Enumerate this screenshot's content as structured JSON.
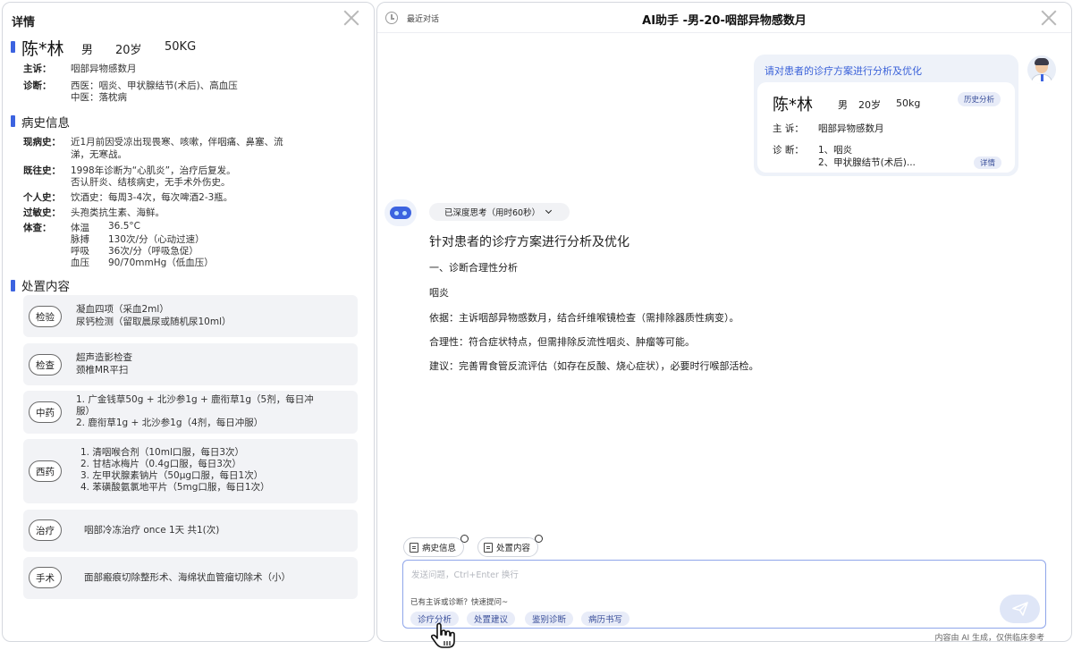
{
  "left": {
    "title": "详情",
    "patient": {
      "name": "陈*林",
      "sex": "男",
      "age": "20岁",
      "weight": "50KG"
    },
    "complaint_label": "主诉：",
    "complaint": "咽部异物感数月",
    "diagnosis_label": "诊断：",
    "diagnosis_western": "西医：咽炎、甲状腺结节(术后)、高血压",
    "diagnosis_tcm": "中医：落枕病",
    "history": {
      "section_title": "病史信息",
      "present_label": "现病史：",
      "present_lines": [
        "近1月前因受凉出现畏寒、咳嗽，伴咽痛、鼻塞、流",
        "涕，无寒战。"
      ],
      "past_label": "既往史：",
      "past_lines": [
        "1998年诊断为“心肌炎”，治疗后复发。",
        "否认肝炎、结核病史，无手术外伤史。"
      ],
      "personal_label": "个人史：",
      "personal": "饮酒史：每周3-4次，每次啤酒2-3瓶。",
      "allergy_label": "过敏史：",
      "allergy": "头孢类抗生素、海鲜。",
      "vitals_label": "体查：",
      "vitals": [
        {
          "name": "体温",
          "value": "36.5°C"
        },
        {
          "name": "脉搏",
          "value": "130次/分（心动过速）"
        },
        {
          "name": "呼吸",
          "value": "36次/分（呼吸急促）"
        },
        {
          "name": "血压",
          "value": "90/70mmHg（低血压）"
        }
      ]
    },
    "treatment": {
      "section_title": "处置内容",
      "items": [
        {
          "tag": "检验",
          "lines": [
            "凝血四项（采血2ml）",
            "尿钙检测（留取晨尿或随机尿10ml）"
          ]
        },
        {
          "tag": "检查",
          "lines": [
            "超声造影检查",
            "颈椎MR平扫"
          ]
        },
        {
          "tag": "中药",
          "lines": [
            "1. 广金钱草50g + 北沙参1g + 鹿衔草1g（5剂，每日冲",
            "服）",
            "2. 鹿衔草1g + 北沙参1g（4剂，每日冲服）"
          ]
        },
        {
          "tag": "西药",
          "lines": [
            "1. 清咽喉合剂（10ml口服，每日3次）",
            "2. 甘桔冰梅片（0.4g口服，每日3次）",
            "3. 左甲状腺素钠片（50μg口服，每日1次）",
            "4. 苯磺酸氨氯地平片（5mg口服，每日1次）"
          ]
        },
        {
          "tag": "治疗",
          "lines": [
            "咽部冷冻治疗 once 1天 共1(次)"
          ]
        },
        {
          "tag": "手术",
          "lines": [
            "面部瘢痕切除整形术、海绵状血管瘤切除术（小）"
          ]
        }
      ]
    }
  },
  "right": {
    "recent_label": "最近对话",
    "title": "AI助手 -男-20-咽部异物感数月",
    "user_prompt": "请对患者的诊疗方案进行分析及优化",
    "card": {
      "name": "陈*林",
      "sex": "男",
      "age": "20岁",
      "weight": "50kg",
      "history_btn": "历史分析",
      "complaint_label": "主  诉：",
      "complaint": "咽部异物感数月",
      "diagnosis_label": "诊  断：",
      "diag1": "1、咽炎",
      "diag2": "2、甲状腺结节(术后)...",
      "detail_btn": "详情"
    },
    "thinking": "已深度思考（用时60秒）",
    "answer": {
      "heading": "针对患者的诊疗方案进行分析及优化",
      "sub": "一、诊断合理性分析",
      "diag": "咽炎",
      "basis": "依据：主诉咽部异物感数月，结合纤维喉镜检查（需排除器质性病变）。",
      "reason": "合理性：符合症状特点，但需排除反流性咽炎、肿瘤等可能。",
      "suggest": "建议：完善胃食管反流评估（如存在反酸、烧心症状），必要时行喉部活检。"
    },
    "quick": {
      "history": "病史信息",
      "treatment": "处置内容"
    },
    "input_placeholder": "发送问题，Ctrl+Enter 换行",
    "hint": "已有主诉或诊断？快速提问~",
    "chips": [
      "诊疗分析",
      "处置建议",
      "鉴别诊断",
      "病历书写"
    ],
    "footer": "内容由 AI 生成，仅供临床参考"
  }
}
